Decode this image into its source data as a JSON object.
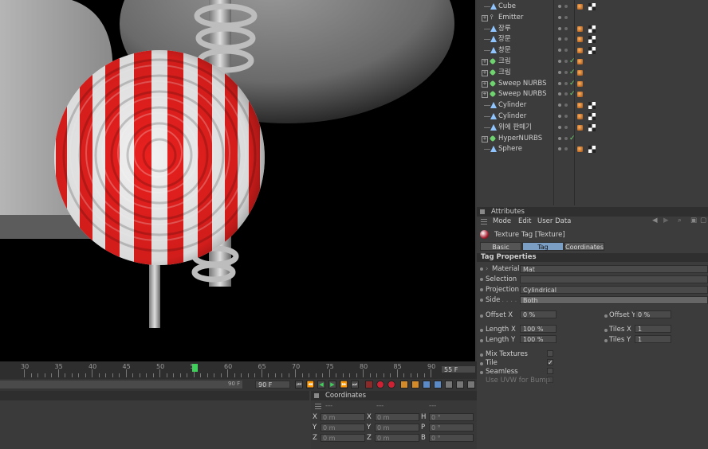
{
  "object_manager": {
    "objects": [
      {
        "name": "Cube",
        "icon": "primitive-icon",
        "indent": 1,
        "check": false,
        "tags": 2
      },
      {
        "name": "Emitter",
        "icon": "emitter-icon",
        "indent": 0,
        "expander": true,
        "check": false,
        "tags": 0
      },
      {
        "name": "장루",
        "icon": "primitive-icon",
        "indent": 1,
        "check": false,
        "tags": 2
      },
      {
        "name": "장문",
        "icon": "primitive-icon",
        "indent": 1,
        "check": false,
        "tags": 2
      },
      {
        "name": "창문",
        "icon": "primitive-icon",
        "indent": 1,
        "check": false,
        "tags": 2
      },
      {
        "name": "크림",
        "icon": "nurbs-icon",
        "indent": 0,
        "expander": true,
        "check": true,
        "tags": 1
      },
      {
        "name": "크림",
        "icon": "nurbs-icon",
        "indent": 0,
        "expander": true,
        "check": true,
        "tags": 1
      },
      {
        "name": "Sweep NURBS",
        "icon": "nurbs-icon",
        "indent": 0,
        "expander": true,
        "check": true,
        "tags": 1
      },
      {
        "name": "Sweep NURBS",
        "icon": "nurbs-icon",
        "indent": 0,
        "expander": true,
        "check": true,
        "tags": 1
      },
      {
        "name": "Cylinder",
        "icon": "primitive-icon",
        "indent": 1,
        "check": false,
        "tags": 2
      },
      {
        "name": "Cylinder",
        "icon": "primitive-icon",
        "indent": 1,
        "check": false,
        "tags": 2
      },
      {
        "name": "위에 판떼기",
        "icon": "primitive-icon",
        "indent": 1,
        "check": false,
        "tags": 2
      },
      {
        "name": "HyperNURBS",
        "icon": "nurbs-icon",
        "indent": 0,
        "expander": true,
        "check": true,
        "tags": 0
      },
      {
        "name": "Sphere",
        "icon": "primitive-icon",
        "indent": 1,
        "check": false,
        "tags": 2
      }
    ]
  },
  "attributes": {
    "panel_title": "Attributes",
    "menu": [
      "Mode",
      "Edit",
      "User Data"
    ],
    "object_title": "Texture Tag [Texture]",
    "tabs": [
      {
        "label": "Basic",
        "active": false
      },
      {
        "label": "Tag",
        "active": true
      },
      {
        "label": "Coordinates",
        "active": false
      }
    ],
    "section": "Tag Properties",
    "material_label": "Material",
    "material_value": "Mat",
    "selection_label": "Selection",
    "selection_value": "",
    "projection_label": "Projection",
    "projection_value": "Cylindrical",
    "side_label": "Side",
    "side_value": "Both",
    "offset_x_label": "Offset X",
    "offset_x_value": "0 %",
    "offset_y_label": "Offset Y",
    "offset_y_value": "0 %",
    "length_x_label": "Length X",
    "length_x_value": "100 %",
    "tiles_x_label": "Tiles X",
    "tiles_x_value": "1",
    "length_y_label": "Length Y",
    "length_y_value": "100 %",
    "tiles_y_label": "Tiles Y",
    "tiles_y_value": "1",
    "mix_textures_label": "Mix Textures",
    "mix_textures_checked": false,
    "tile_label": "Tile",
    "tile_checked": true,
    "seamless_label": "Seamless",
    "seamless_checked": false,
    "use_uvw_label": "Use UVW for Bump",
    "use_uvw_checked": false
  },
  "timeline": {
    "ticks": [
      "30",
      "35",
      "40",
      "45",
      "50",
      "55",
      "60",
      "65",
      "70",
      "75",
      "80",
      "85",
      "90"
    ],
    "current_frame_label": "55",
    "current_frame_field": "55 F",
    "end_frame_field": "90 F",
    "end_frame_display": "90 F"
  },
  "coordinates": {
    "title": "Coordinates",
    "headers": [
      "---",
      "---",
      "---"
    ],
    "rows": [
      {
        "pos_axis": "X",
        "pos": "0 m",
        "size_axis": "X",
        "size": "0 m",
        "rot_axis": "H",
        "rot": "0 °"
      },
      {
        "pos_axis": "Y",
        "pos": "0 m",
        "size_axis": "Y",
        "size": "0 m",
        "rot_axis": "P",
        "rot": "0 °"
      },
      {
        "pos_axis": "Z",
        "pos": "0 m",
        "size_axis": "Z",
        "size": "0 m",
        "rot_axis": "B",
        "rot": "0 °"
      }
    ]
  }
}
